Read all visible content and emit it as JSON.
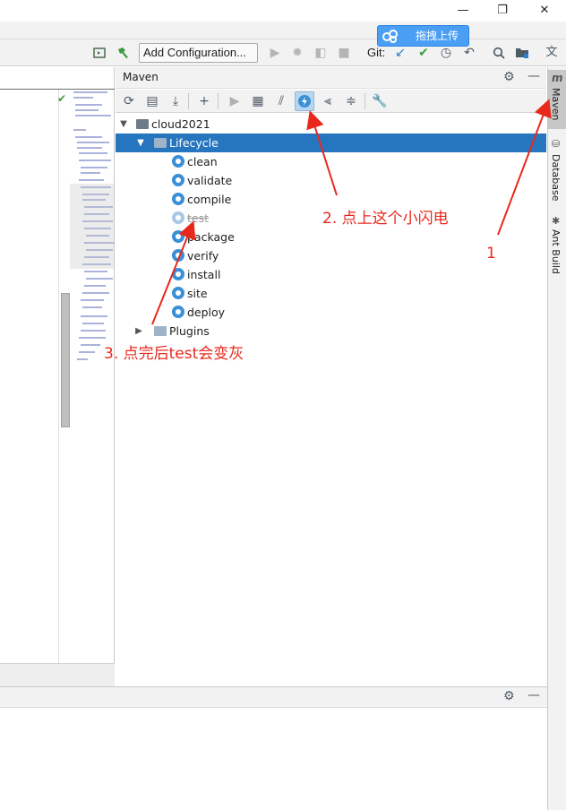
{
  "window": {
    "minimize_glyph": "—",
    "restore_glyph": "❐",
    "close_glyph": "✕"
  },
  "toolbar": {
    "add_config_label": "Add Configuration...",
    "git_label": "Git:",
    "upload_label": "拖拽上传"
  },
  "maven": {
    "title": "Maven",
    "project": "cloud2021",
    "lifecycle_label": "Lifecycle",
    "phases": [
      "clean",
      "validate",
      "compile",
      "test",
      "package",
      "verify",
      "install",
      "site",
      "deploy"
    ],
    "plugins_label": "Plugins"
  },
  "side_tabs": {
    "maven": "Maven",
    "database": "Database",
    "ant": "Ant Build"
  },
  "annotations": {
    "step1": "1",
    "step2": "2. 点上这个小闪电",
    "step3": "3. 点完后test会变灰"
  },
  "colors": {
    "selection": "#2675bf",
    "annotation_red": "#e8281c",
    "gear_blue": "#3a8fd6",
    "upload_blue": "#4a9ff5"
  }
}
